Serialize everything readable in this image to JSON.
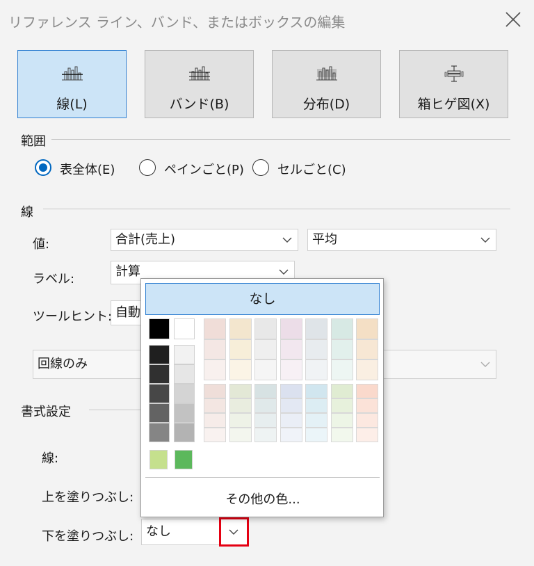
{
  "dialog": {
    "title": "リファレンス ライン、バンド、またはボックスの編集"
  },
  "type_buttons": [
    {
      "label": "線(L)",
      "icon": "line-chart-icon",
      "selected": true
    },
    {
      "label": "バンド(B)",
      "icon": "band-chart-icon",
      "selected": false
    },
    {
      "label": "分布(D)",
      "icon": "distribution-chart-icon",
      "selected": false
    },
    {
      "label": "箱ヒゲ図(X)",
      "icon": "boxplot-chart-icon",
      "selected": false
    }
  ],
  "scope": {
    "heading": "範囲",
    "options": [
      {
        "label": "表全体(E)",
        "selected": true
      },
      {
        "label": "ペインごと(P)",
        "selected": false
      },
      {
        "label": "セルごと(C)",
        "selected": false
      }
    ]
  },
  "line": {
    "heading": "線",
    "value_label": "値:",
    "value_field": "合計(売上)",
    "aggregation": "平均",
    "label_label": "ラベル:",
    "label_value": "計算",
    "tooltip_label": "ツールヒント:",
    "tooltip_value": "自動",
    "display_value": "回線のみ"
  },
  "format": {
    "heading": "書式設定",
    "line_label": "線:",
    "fill_above_label": "上を塗りつぶし:",
    "fill_below_label": "下を塗りつぶし:",
    "fill_below_value": "なし"
  },
  "color_popup": {
    "none_label": "なし",
    "more_colors_label": "その他の色...",
    "column_top": [
      "#000000",
      "#ffffff"
    ],
    "dark_col": [
      "#1f1f1f",
      "#303030",
      "#474747",
      "#636363",
      "#858585"
    ],
    "light_col": [
      "#f2f2f2",
      "#e6e6e6",
      "#d4d4d4",
      "#c2c2c2",
      "#b3b3b3"
    ],
    "top_palette": [
      [
        "#f0ddd8",
        "#f3e6ce",
        "#e8e8e8",
        "#ecdde8",
        "#dfe4e8",
        "#d7e9e4",
        "#f4dfc5"
      ],
      [
        "#f4e7e4",
        "#f7eed9",
        "#efefef",
        "#f2e7ef",
        "#e8ecef",
        "#e2f0ec",
        "#f7e7d4"
      ],
      [
        "#f8f0ee",
        "#fbf4e6",
        "#f5f5f5",
        "#f7f0f5",
        "#f0f3f5",
        "#edf6f3",
        "#faefe2"
      ]
    ],
    "bottom_palette": [
      [
        "#efded9",
        "#e3e8d6",
        "#d7e2e3",
        "#dbe1ef",
        "#d1e6ef",
        "#e0ecd2",
        "#fad9cc"
      ],
      [
        "#f3e6e2",
        "#e9eddf",
        "#e0e9ea",
        "#e3e8f3",
        "#dcedf3",
        "#e7f1dc",
        "#fbe2d8"
      ],
      [
        "#f6ece9",
        "#eef2e7",
        "#e7eeef",
        "#eaeef6",
        "#e4f1f6",
        "#edf5e6",
        "#fce8e0"
      ],
      [
        "#f9f2f0",
        "#f3f6ee",
        "#eef3f3",
        "#f0f3f9",
        "#ebf5f9",
        "#f2f8ed",
        "#fdeee8"
      ]
    ],
    "extra": [
      "#c5e08d",
      "#5cb85c"
    ]
  },
  "colors": {
    "accent": "#0067c0",
    "selected_fill": "#cce4f7",
    "highlight": "#e50012"
  }
}
